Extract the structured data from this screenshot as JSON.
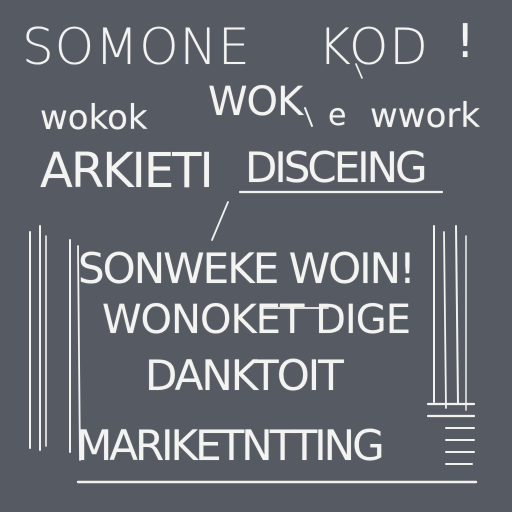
{
  "lines": {
    "l1a": "SOMONE",
    "l1b": "KOD",
    "l1c": "!",
    "l2a": "wokok",
    "l2b": "WOK",
    "l2c": "e",
    "l2d": "wwork",
    "l3a": "ARKIETI",
    "l3b": "DISCEING"
  },
  "box": {
    "line1": "SONWEKE WOIN!",
    "line2": "WONOKET DIGE",
    "line3": "DANKTOIT",
    "line4": "MARIKETNTTING"
  },
  "colors": {
    "background": "#565b63",
    "chalk": "#f3f3f1"
  }
}
